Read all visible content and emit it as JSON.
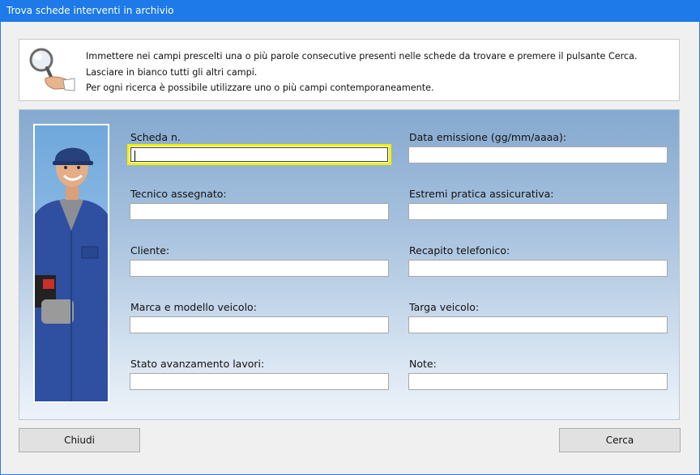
{
  "window": {
    "title": "Trova schede interventi in archivio"
  },
  "info": {
    "icon": "magnifier-icon",
    "lines": [
      "Immettere nei campi prescelti una o più parole consecutive presenti nelle schede da trovare e premere il pulsante Cerca.",
      "Lasciare in bianco tutti gli altri campi.",
      "Per ogni ricerca è possibile utilizzare uno o più campi contemporaneamente."
    ]
  },
  "form": {
    "left": [
      {
        "label": "Scheda n.",
        "value": ""
      },
      {
        "label": "Tecnico assegnato:",
        "value": ""
      },
      {
        "label": "Cliente:",
        "value": ""
      },
      {
        "label": "Marca e modello veicolo:",
        "value": ""
      },
      {
        "label": "Stato avanzamento lavori:",
        "value": ""
      }
    ],
    "right": [
      {
        "label": "Data emissione (gg/mm/aaaa):",
        "value": ""
      },
      {
        "label": "Estremi pratica assicurativa:",
        "value": ""
      },
      {
        "label": "Recapito telefonico:",
        "value": ""
      },
      {
        "label": "Targa veicolo:",
        "value": ""
      },
      {
        "label": "Note:",
        "value": ""
      }
    ]
  },
  "buttons": {
    "close": "Chiudi",
    "search": "Cerca"
  },
  "colors": {
    "titlebar": "#1d7ae8",
    "focus_highlight": "#f2f200"
  }
}
